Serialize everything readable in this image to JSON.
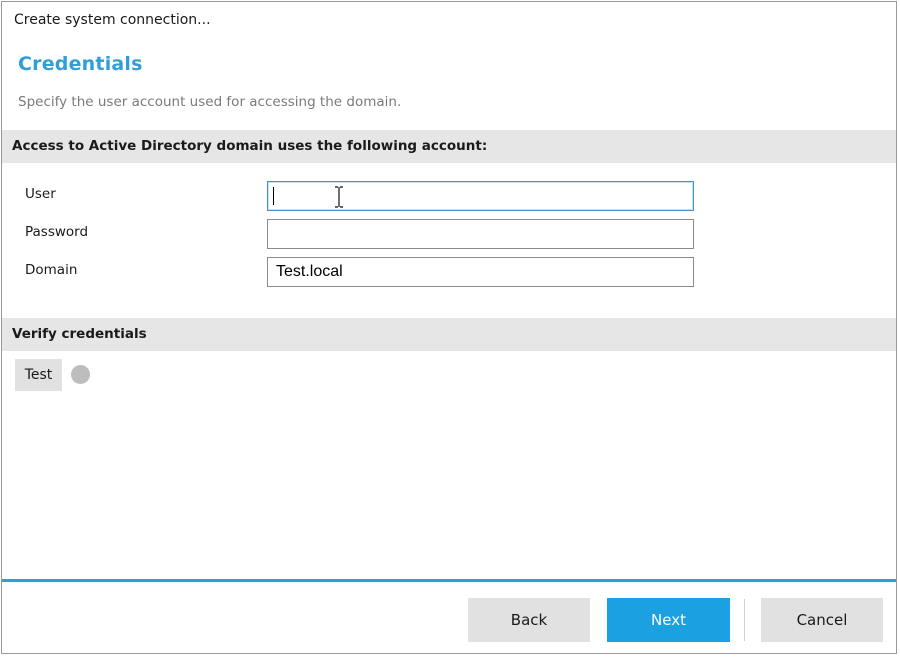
{
  "window": {
    "title": "Create system connection..."
  },
  "page": {
    "heading": "Credentials",
    "subtitle": "Specify the user account used for accessing the domain."
  },
  "account_section": {
    "title": "Access to Active Directory domain uses the following account:",
    "fields": {
      "user": {
        "label": "User",
        "value": ""
      },
      "password": {
        "label": "Password",
        "value": ""
      },
      "domain": {
        "label": "Domain",
        "value": "Test.local"
      }
    }
  },
  "verify_section": {
    "title": "Verify credentials",
    "test_label": "Test",
    "status_color": "#bdbdbd"
  },
  "footer": {
    "back_label": "Back",
    "next_label": "Next",
    "cancel_label": "Cancel"
  },
  "colors": {
    "accent": "#1ba1e2",
    "heading": "#2f9fd8",
    "section_bar": "#e6e6e6"
  },
  "icons": {
    "status": "status-indicator-icon",
    "cursor": "text-cursor-icon"
  }
}
